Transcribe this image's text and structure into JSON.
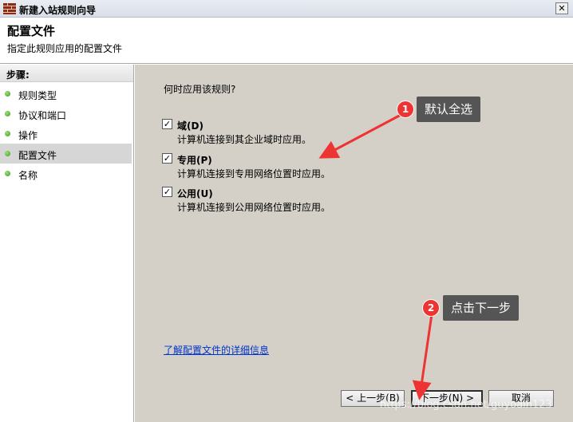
{
  "window": {
    "title": "新建入站规则向导",
    "close_glyph": "✕"
  },
  "header": {
    "title": "配置文件",
    "subtitle": "指定此规则应用的配置文件"
  },
  "sidebar": {
    "heading": "步骤:",
    "items": [
      {
        "label": "规则类型"
      },
      {
        "label": "协议和端口"
      },
      {
        "label": "操作"
      },
      {
        "label": "配置文件",
        "active": true
      },
      {
        "label": "名称"
      }
    ]
  },
  "content": {
    "question": "何时应用该规则?",
    "options": [
      {
        "label": "域(D)",
        "description": "计算机连接到其企业域时应用。",
        "checked": true
      },
      {
        "label": "专用(P)",
        "description": "计算机连接到专用网络位置时应用。",
        "checked": true
      },
      {
        "label": "公用(U)",
        "description": "计算机连接到公用网络位置时应用。",
        "checked": true
      }
    ],
    "help_link": "了解配置文件的详细信息"
  },
  "buttons": {
    "back": "< 上一步(B)",
    "next": "下一步(N) >",
    "cancel": "取消"
  },
  "annotations": [
    {
      "number": "1",
      "text": "默认全选"
    },
    {
      "number": "2",
      "text": "点击下一步"
    }
  ],
  "watermark": "https://blog.csdn.net/guyoain123",
  "colors": {
    "content_bg": "#d4d0c8",
    "active_step": "#d6d6d6",
    "callout_bg": "#555555",
    "badge": "#e33333",
    "arrow": "#e33333",
    "link": "#0033cc"
  }
}
